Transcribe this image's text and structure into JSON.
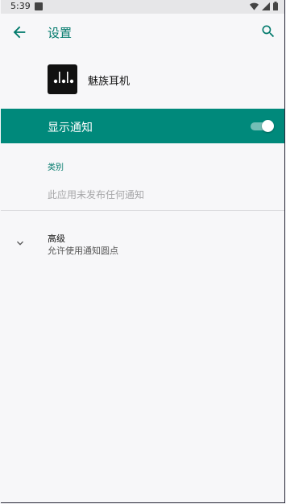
{
  "status_bar": {
    "time": "5:39"
  },
  "app_bar": {
    "title": "设置"
  },
  "app_header": {
    "app_name": "魅族耳机"
  },
  "notification_toggle": {
    "label": "显示通知",
    "enabled": true
  },
  "category_section": {
    "header": "类别",
    "empty_message": "此应用未发布任何通知"
  },
  "advanced": {
    "title": "高级",
    "summary": "允许使用通知圆点"
  },
  "colors": {
    "accent": "#00796b",
    "toggle_row_bg": "#00897b",
    "background": "#f7f7f9"
  }
}
